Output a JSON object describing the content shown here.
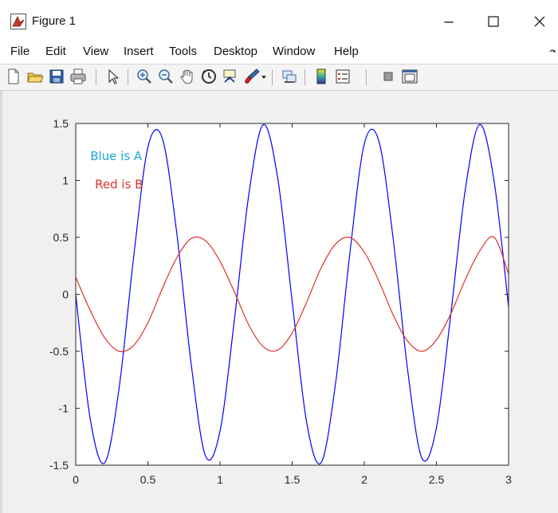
{
  "window": {
    "title": "Figure 1"
  },
  "menu": [
    {
      "label": "File"
    },
    {
      "label": "Edit"
    },
    {
      "label": "View"
    },
    {
      "label": "Insert"
    },
    {
      "label": "Tools"
    },
    {
      "label": "Desktop"
    },
    {
      "label": "Window"
    },
    {
      "label": "Help"
    }
  ],
  "toolbar_icons": [
    "new-figure-icon",
    "open-file-icon",
    "save-icon",
    "print-icon",
    "edit-plot-icon",
    "zoom-in-icon",
    "zoom-out-icon",
    "pan-icon",
    "rotate-3d-icon",
    "data-cursor-icon",
    "brush-icon",
    "link-plot-icon",
    "insert-colorbar-icon",
    "insert-legend-icon",
    "hide-plot-tools-icon",
    "show-plot-tools-icon"
  ],
  "colors": {
    "blue": "#0000ff",
    "red": "#e0312a",
    "annot_blue": "#1aa8d8",
    "annot_red": "#e0312a"
  },
  "chart_data": {
    "type": "line",
    "title": "",
    "xlabel": "",
    "ylabel": "",
    "xlim": [
      0,
      3
    ],
    "ylim": [
      -1.5,
      1.5
    ],
    "xticks": [
      0,
      0.5,
      1,
      1.5,
      2,
      2.5,
      3
    ],
    "xtick_labels": [
      "0",
      "0.5",
      "1",
      "1.5",
      "2",
      "2.5",
      "3"
    ],
    "yticks": [
      -1.5,
      -1,
      -0.5,
      0,
      0.5,
      1,
      1.5
    ],
    "ytick_labels": [
      "-1.5",
      "-1",
      "-0.5",
      "0",
      "0.5",
      "1",
      "1.5"
    ],
    "grid": false,
    "series": [
      {
        "color": "#0000ff",
        "x": [
          0,
          0.1,
          0.2,
          0.3,
          0.4,
          0.5,
          0.6,
          0.7,
          0.8,
          0.9,
          1,
          1.1,
          1.2,
          1.3,
          1.4,
          1.5,
          1.6,
          1.7,
          1.8,
          1.9,
          2,
          2.1,
          2.2,
          2.3,
          2.4,
          2.5,
          2.6,
          2.7,
          2.8,
          2.9,
          3
        ],
        "values": [
          0,
          -1.09,
          -1.48,
          -0.83,
          0.31,
          1.29,
          1.37,
          0.54,
          -0.61,
          -1.42,
          -1.2,
          -0.22,
          0.88,
          1.49,
          1.02,
          -0.06,
          -1.12,
          -1.48,
          -0.79,
          0.36,
          1.32,
          1.35,
          0.49,
          -0.66,
          -1.44,
          -1.17,
          -0.17,
          0.92,
          1.49,
          0.99,
          -0.11
        ]
      },
      {
        "color": "#e0312a",
        "x": [
          0,
          0.1,
          0.2,
          0.3,
          0.4,
          0.5,
          0.6,
          0.7,
          0.8,
          0.9,
          1,
          1.1,
          1.2,
          1.3,
          1.4,
          1.5,
          1.6,
          1.7,
          1.8,
          1.9,
          2,
          2.1,
          2.2,
          2.3,
          2.4,
          2.5,
          2.6,
          2.7,
          2.8,
          2.9,
          3
        ],
        "values": [
          0.15,
          -0.14,
          -0.38,
          -0.5,
          -0.45,
          -0.25,
          0.05,
          0.32,
          0.49,
          0.47,
          0.29,
          0.02,
          -0.27,
          -0.46,
          -0.49,
          -0.34,
          -0.07,
          0.23,
          0.44,
          0.5,
          0.37,
          0.12,
          -0.18,
          -0.41,
          -0.5,
          -0.4,
          -0.17,
          0.13,
          0.38,
          0.5,
          0.18
        ]
      }
    ],
    "annotations": [
      {
        "text": "Blue is A",
        "x": 0.28,
        "y": 1.18,
        "color": "#1aa8d8"
      },
      {
        "text": "Red is B",
        "x": 0.3,
        "y": 0.93,
        "color": "#e0312a"
      }
    ]
  }
}
